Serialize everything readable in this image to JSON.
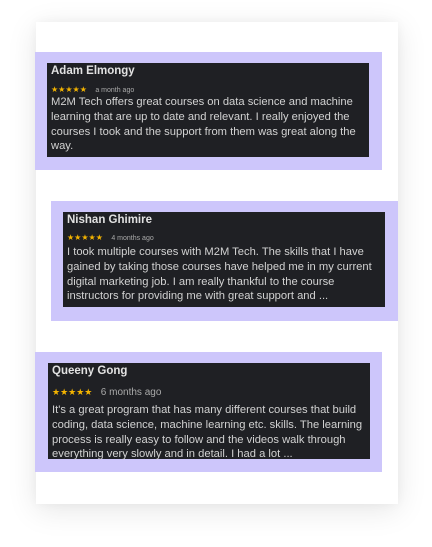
{
  "colors": {
    "frame": "#cdc6fb",
    "card": "#1f2024",
    "star": "#f4b400",
    "text": "#d2d2d2"
  },
  "reviews": [
    {
      "name": "Adam Elmongy",
      "stars": "★★★★★",
      "rating": 5,
      "time": "a month ago",
      "text": "M2M Tech offers great courses on data science and machine learning that are up to date and relevant. I really enjoyed the courses I took and the support from them was great along the way."
    },
    {
      "name": "Nishan Ghimire",
      "stars": "★★★★★",
      "rating": 5,
      "time": "4 months ago",
      "text": "I took multiple courses with M2M Tech. The skills that I have gained by taking those courses have helped me in my current digital marketing job. I am really thankful to the course instructors for providing me with great support and ..."
    },
    {
      "name": "Queeny Gong",
      "stars": "★★★★★",
      "rating": 5,
      "time": "6 months ago",
      "text": "It's a great program that has many different courses that build coding, data science, machine learning etc. skills. The learning process is really easy to follow and the videos walk through everything very slowly and in detail. I had a lot ..."
    }
  ]
}
